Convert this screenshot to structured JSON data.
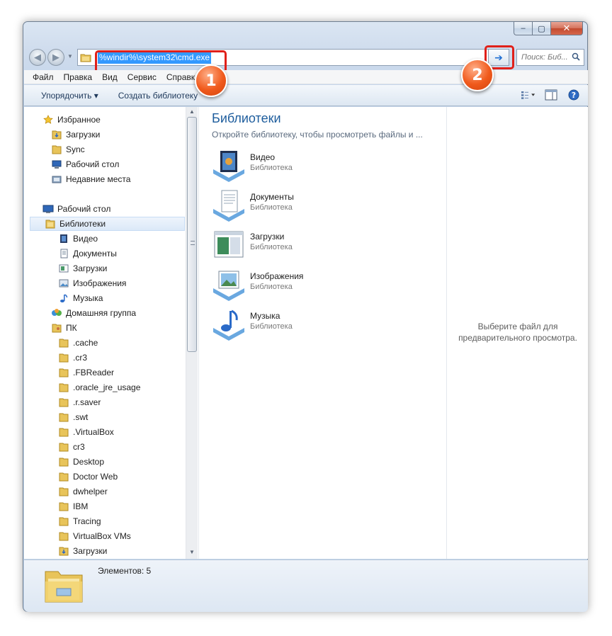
{
  "window": {
    "min_label": "‒",
    "max_label": "▢",
    "close_label": "✕"
  },
  "address": {
    "value": "%windir%\\system32\\cmd.exe",
    "go_label": "➔"
  },
  "search": {
    "placeholder": "Поиск: Биб..."
  },
  "badges": [
    "1",
    "2"
  ],
  "menu": [
    "Файл",
    "Правка",
    "Вид",
    "Сервис",
    "Справка"
  ],
  "toolbar": {
    "organize": "Упорядочить ▾",
    "new_library": "Создать библиотеку"
  },
  "nav": {
    "favorites": "Избранное",
    "fav_items": [
      "Загрузки",
      "Sync",
      "Рабочий стол",
      "Недавние места"
    ],
    "desktop": "Рабочий стол",
    "libraries": "Библиотеки",
    "lib_items": [
      "Видео",
      "Документы",
      "Загрузки",
      "Изображения",
      "Музыка"
    ],
    "homegroup": "Домашняя группа",
    "pc": "ПК",
    "pc_items": [
      ".cache",
      ".cr3",
      ".FBReader",
      ".oracle_jre_usage",
      ".r.saver",
      ".swt",
      ".VirtualBox",
      "cr3",
      "Desktop",
      "Doctor Web",
      "dwhelper",
      "IBM",
      "Tracing",
      "VirtualBox VMs",
      "Загрузки"
    ]
  },
  "main": {
    "title": "Библиотеки",
    "subtitle": "Откройте библиотеку, чтобы просмотреть файлы и ...",
    "items": [
      {
        "name": "Видео",
        "type": "Библиотека"
      },
      {
        "name": "Документы",
        "type": "Библиотека"
      },
      {
        "name": "Загрузки",
        "type": "Библиотека"
      },
      {
        "name": "Изображения",
        "type": "Библиотека"
      },
      {
        "name": "Музыка",
        "type": "Библиотека"
      }
    ]
  },
  "preview": {
    "line1": "Выберите файл для",
    "line2": "предварительного просмотра."
  },
  "details": {
    "count": "Элементов: 5"
  },
  "colors": {
    "accent": "#1e5d9d",
    "selection": "#3399ff",
    "highlight": "#e0201a",
    "badge": "#f05a1c"
  }
}
